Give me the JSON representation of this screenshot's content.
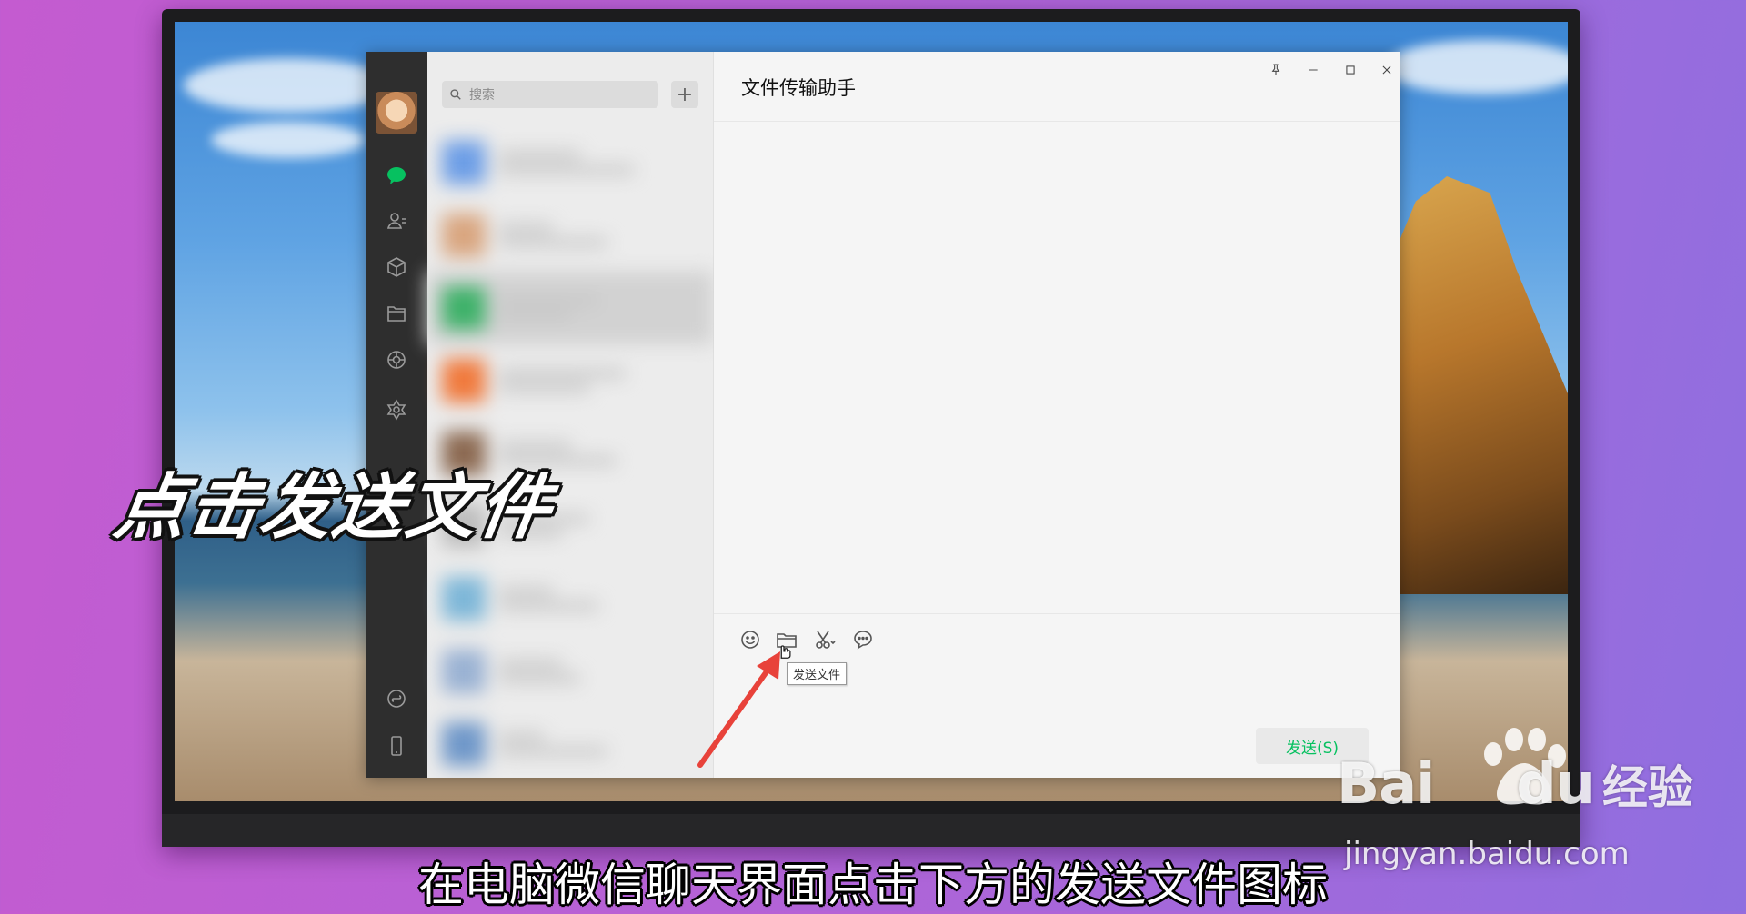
{
  "nav": {
    "icons": [
      "chat-icon",
      "contacts-icon",
      "favorites-icon",
      "files-icon",
      "moments-icon",
      "discover-icon",
      "mini-program-icon",
      "phone-icon",
      "menu-icon"
    ],
    "active_color": "#07c160"
  },
  "search": {
    "placeholder": "搜索"
  },
  "add_label": "+",
  "chat": {
    "title": "文件传输助手"
  },
  "toolbar": {
    "tooltip": "发送文件"
  },
  "send_label": "发送(S)",
  "overlay_title": "点击发送文件",
  "caption": "在电脑微信聊天界面点击下方的发送文件图标",
  "watermark": {
    "brand": "Bai",
    "brand2": "du",
    "cn": "经验",
    "url": "jingyan.baidu.com"
  },
  "colors": {
    "accent": "#07c160",
    "arrow": "#e8423a"
  }
}
